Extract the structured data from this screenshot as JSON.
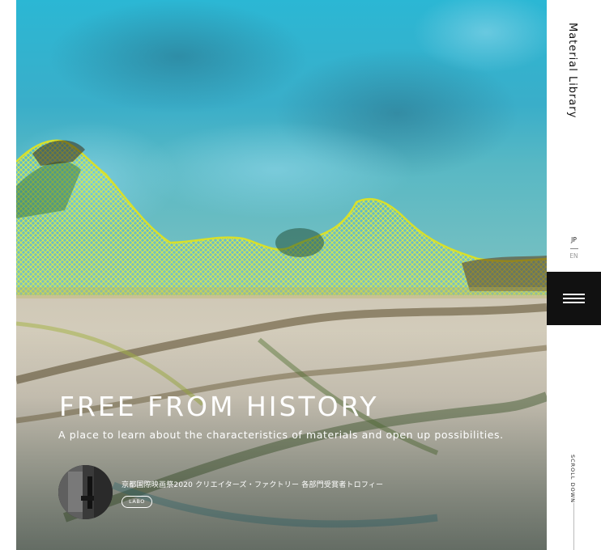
{
  "hero": {
    "title": "FREE FROM HISTORY",
    "subtitle": "A place to learn about the characteristics of materials and open up possibilities."
  },
  "feature": {
    "title": "京都国際映画祭2020 クリエイターズ・ファクトリー 各部門受賞者トロフィー",
    "tag": "LABO"
  },
  "rail": {
    "brand": "Material Library",
    "lang_active": "JP",
    "lang_inactive": "EN",
    "scroll": "SCROLL DOWN"
  },
  "colors": {
    "accent_dark": "#111111",
    "sky": "#3ab4cf",
    "net": "#c8d628"
  },
  "icons": [
    "hamburger-menu-icon"
  ]
}
